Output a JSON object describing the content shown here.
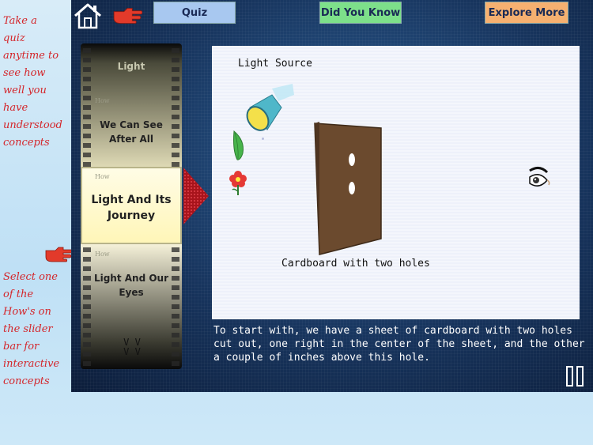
{
  "left_notes": {
    "quiz_tip": [
      "Take a",
      "quiz",
      "anytime to",
      "see how",
      "well you",
      "have",
      "understood",
      "concepts"
    ],
    "slider_tip": [
      "Select one",
      "of the",
      "How's on",
      "the slider",
      "bar for",
      "interactive",
      "concepts"
    ]
  },
  "toolbar": {
    "quiz_label": "Quiz",
    "did_you_know_label": "Did You Know",
    "explore_more_label": "Explore More"
  },
  "slider": {
    "how_label": "How",
    "items": [
      {
        "line1": "Light",
        "line2": ""
      },
      {
        "line1": "We Can See",
        "line2": "After All"
      },
      {
        "line1": "Light And Its",
        "line2": "Journey"
      },
      {
        "line1": "Light And Our",
        "line2": "Eyes"
      }
    ],
    "more_marks": "V V\nV V"
  },
  "scene": {
    "light_source_label": "Light Source",
    "cardboard_label": "Cardboard with two holes"
  },
  "caption": "To start with, we have a sheet of cardboard with two holes cut out, one right in the center of the sheet, and the other a couple of inches above this hole.",
  "colors": {
    "note_red": "#d4252a",
    "quiz_bg": "#a8c8f0",
    "did_you_know_bg": "#7de08a",
    "explore_more_bg": "#f6b070",
    "cardboard": "#6b4a2e"
  }
}
